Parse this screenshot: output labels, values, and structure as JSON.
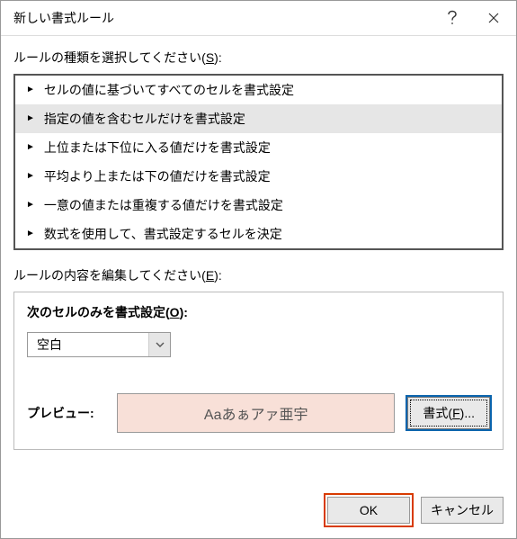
{
  "title": "新しい書式ルール",
  "sectionSelectPrefix": "ルールの種類を選択してください(",
  "sectionSelectKey": "S",
  "sectionSelectSuffix": "):",
  "ruleTypes": [
    "セルの値に基づいてすべてのセルを書式設定",
    "指定の値を含むセルだけを書式設定",
    "上位または下位に入る値だけを書式設定",
    "平均より上または下の値だけを書式設定",
    "一意の値または重複する値だけを書式設定",
    "数式を使用して、書式設定するセルを決定"
  ],
  "selectedRuleIndex": 1,
  "sectionEditPrefix": "ルールの内容を編集してください(",
  "sectionEditKey": "E",
  "sectionEditSuffix": "):",
  "editTitlePrefix": "次のセルのみを書式設定(",
  "editTitleKey": "O",
  "editTitleSuffix": "):",
  "dropdownValue": "空白",
  "previewLabel": "プレビュー:",
  "previewText": "Aaあぁアァ亜宇",
  "formatBtnPrefix": "書式(",
  "formatBtnKey": "F",
  "formatBtnSuffix": ")...",
  "okLabel": "OK",
  "cancelLabel": "キャンセル"
}
